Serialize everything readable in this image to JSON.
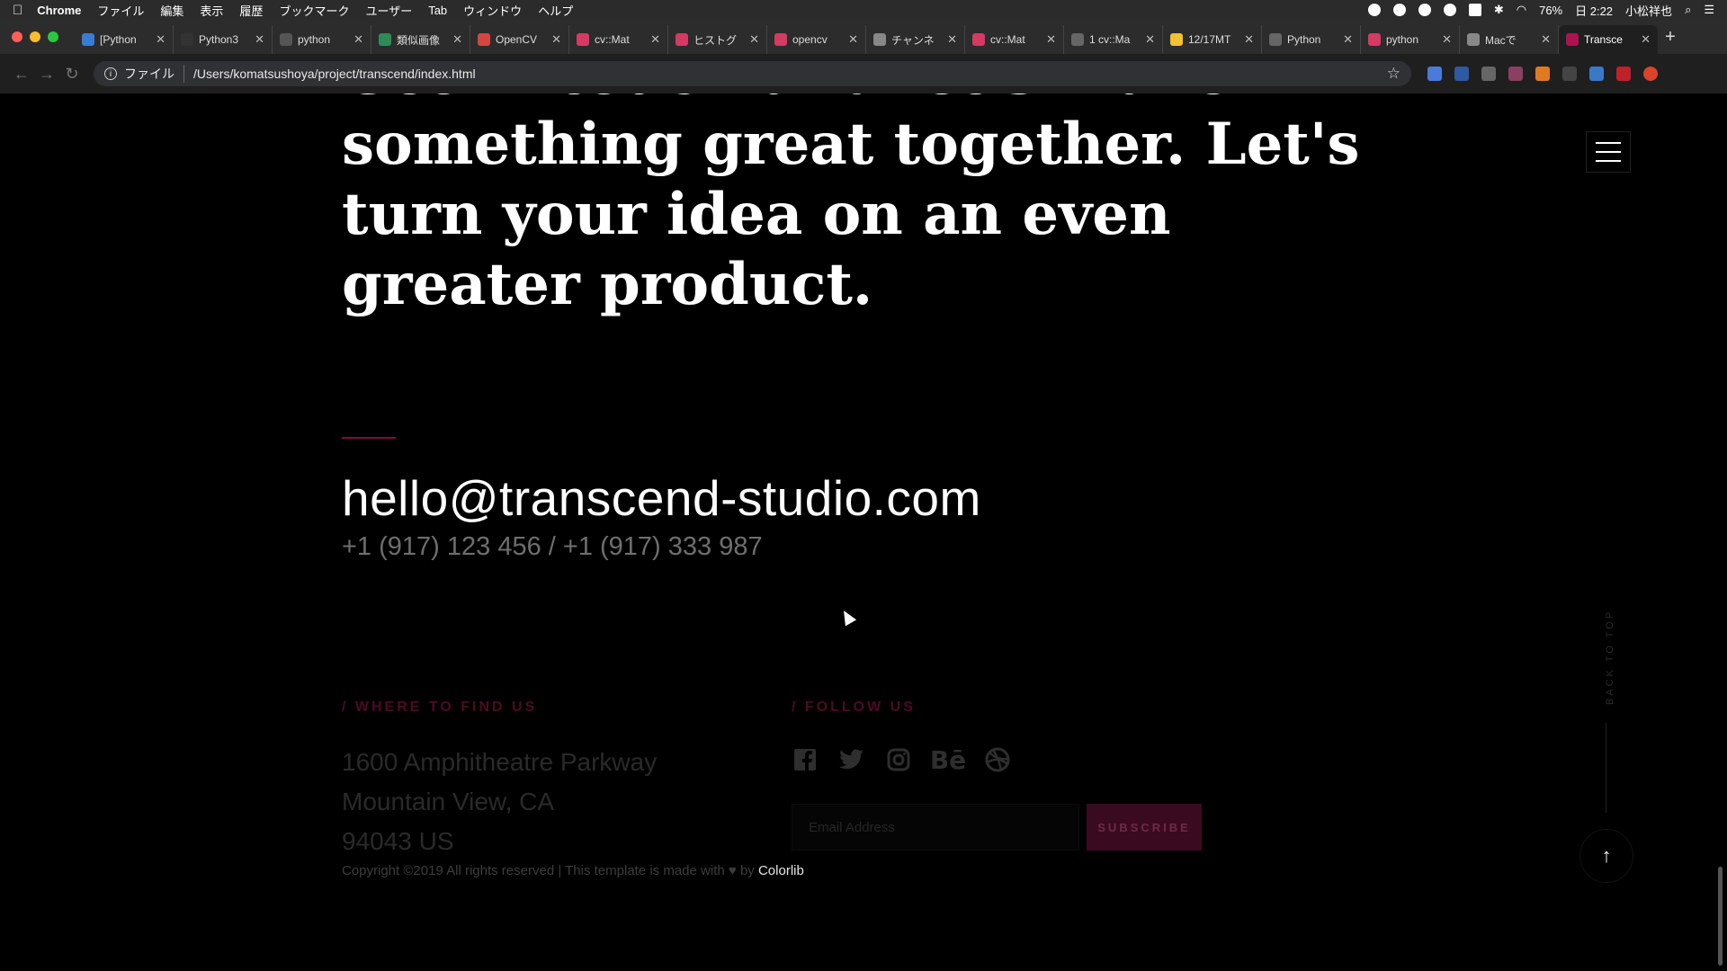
{
  "menubar": {
    "app_name": "Chrome",
    "items": [
      "ファイル",
      "編集",
      "表示",
      "履歴",
      "ブックマーク",
      "ユーザー",
      "Tab",
      "ウィンドウ",
      "ヘルプ"
    ],
    "battery": "76%",
    "clock": "日 2:22",
    "user": "小松祥也"
  },
  "tabs": [
    {
      "title": "[Python",
      "color": "#3a7bd5"
    },
    {
      "title": "Python3",
      "color": "#333333"
    },
    {
      "title": "python",
      "color": "#555555"
    },
    {
      "title": "類似画像",
      "color": "#2e8b57"
    },
    {
      "title": "OpenCV",
      "color": "#d64541"
    },
    {
      "title": "cv::Mat",
      "color": "#d63964"
    },
    {
      "title": "ヒストグ",
      "color": "#d63964"
    },
    {
      "title": "opencv",
      "color": "#d63964"
    },
    {
      "title": "チャンネ",
      "color": "#888888"
    },
    {
      "title": "cv::Mat",
      "color": "#d63964"
    },
    {
      "title": "1 cv::Ma",
      "color": "#666666"
    },
    {
      "title": "12/17MT",
      "color": "#f2c12e"
    },
    {
      "title": "Python",
      "color": "#666666"
    },
    {
      "title": "python",
      "color": "#d63964"
    },
    {
      "title": "Macで",
      "color": "#888888"
    },
    {
      "title": "Transce",
      "color": "#b0124f"
    }
  ],
  "address_bar": {
    "scheme_label": "ファイル",
    "url": "/Users/komatsushoya/project/transcend/index.html"
  },
  "page": {
    "headline": "Get in touch and let's make something great together. Let's turn your idea on an even greater product.",
    "email": "hello@transcend-studio.com",
    "phones": "+1 (917) 123 456 / +1 (917) 333 987",
    "find_us_title": "/ WHERE TO FIND US",
    "address_lines": [
      "1600 Amphitheatre Parkway",
      "Mountain View, CA",
      "94043 US"
    ],
    "follow_us_title": "/ FOLLOW US",
    "socials": [
      "facebook-icon",
      "twitter-icon",
      "instagram-icon",
      "behance-icon",
      "dribbble-icon"
    ],
    "email_placeholder": "Email Address",
    "subscribe_label": "SUBSCRIBE",
    "copyright_text": "Copyright ©2019 All rights reserved | This template is made with",
    "copyright_by": "by",
    "copyright_link": "Colorlib",
    "back_to_top": "BACK TO TOP"
  }
}
